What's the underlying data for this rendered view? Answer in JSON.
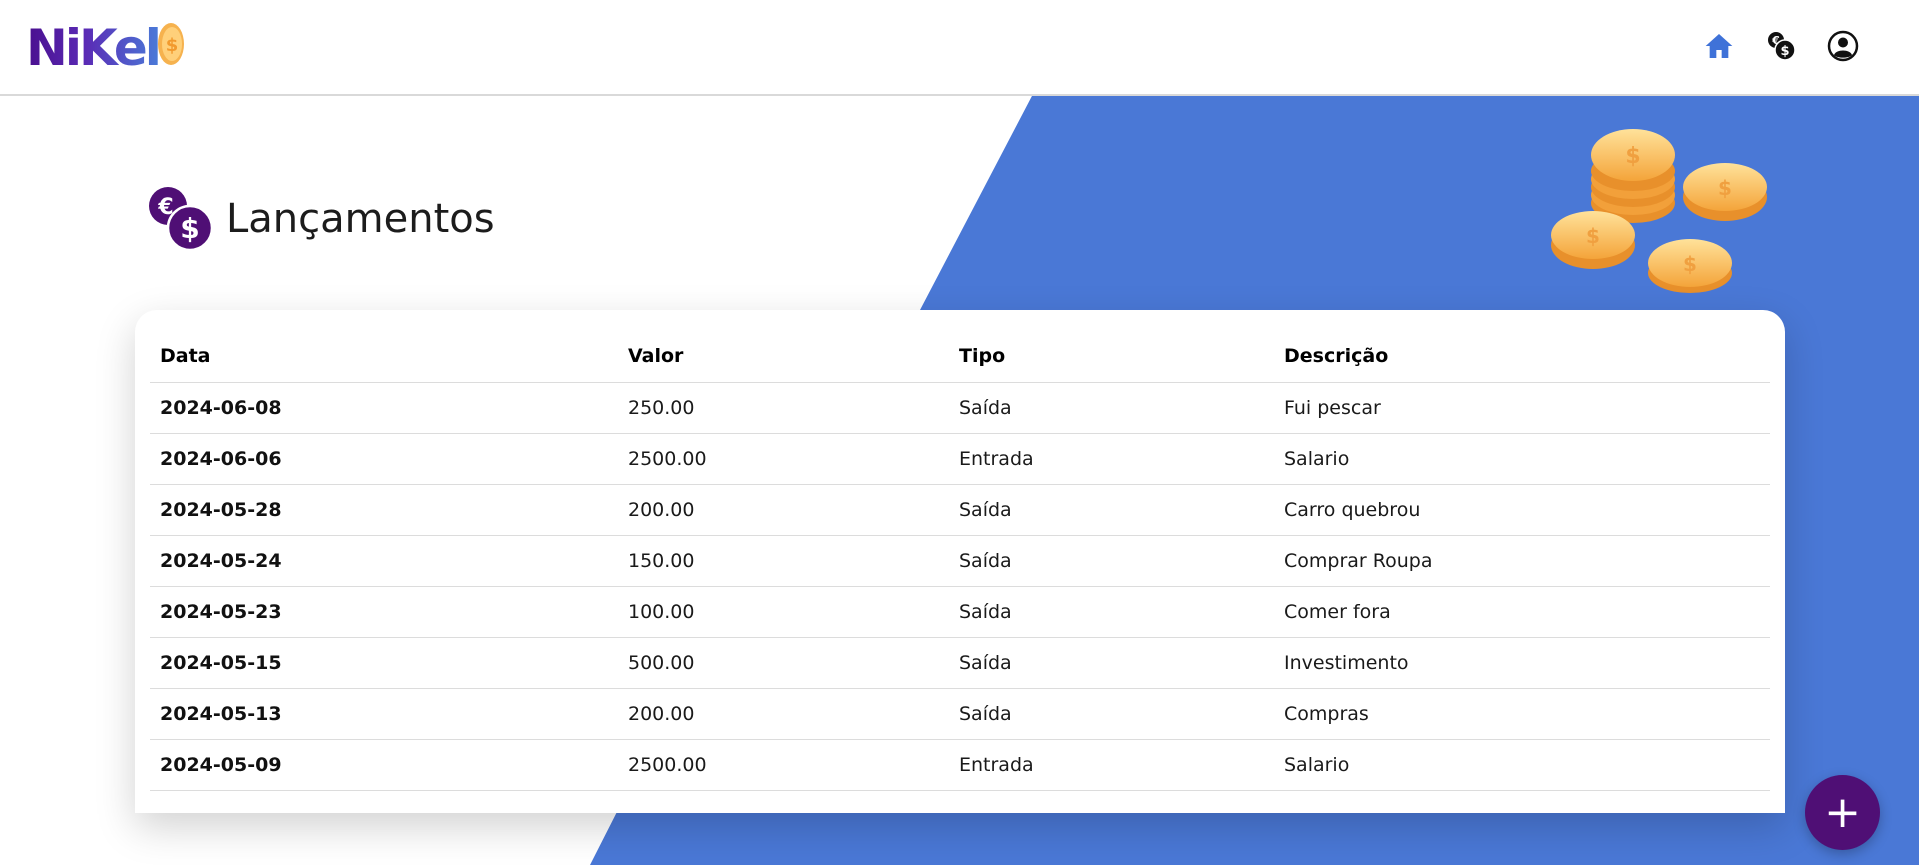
{
  "header": {
    "logo_text": "NiKel",
    "icons": [
      "home-icon",
      "transactions-icon",
      "user-icon"
    ]
  },
  "page": {
    "title": "Lançamentos",
    "title_icon": "currency-icon"
  },
  "table": {
    "columns": [
      "Data",
      "Valor",
      "Tipo",
      "Descrição"
    ],
    "rows": [
      {
        "date": "2024-06-08",
        "value": "250.00",
        "type": "Saída",
        "description": "Fui pescar"
      },
      {
        "date": "2024-06-06",
        "value": "2500.00",
        "type": "Entrada",
        "description": "Salario"
      },
      {
        "date": "2024-05-28",
        "value": "200.00",
        "type": "Saída",
        "description": "Carro quebrou"
      },
      {
        "date": "2024-05-24",
        "value": "150.00",
        "type": "Saída",
        "description": "Comprar Roupa"
      },
      {
        "date": "2024-05-23",
        "value": "100.00",
        "type": "Saída",
        "description": "Comer fora"
      },
      {
        "date": "2024-05-15",
        "value": "500.00",
        "type": "Saída",
        "description": "Investimento"
      },
      {
        "date": "2024-05-13",
        "value": "200.00",
        "type": "Saída",
        "description": "Compras"
      },
      {
        "date": "2024-05-09",
        "value": "2500.00",
        "type": "Entrada",
        "description": "Salario"
      }
    ]
  },
  "fab": {
    "label": "+",
    "icon": "plus-icon"
  },
  "colors": {
    "brand_purple": "#4f0f75",
    "accent_blue": "#4a78d6",
    "nav_home_blue": "#3f72d8"
  }
}
